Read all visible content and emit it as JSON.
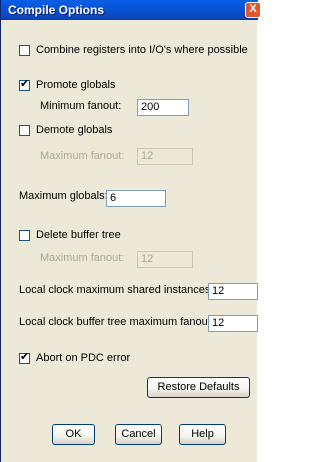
{
  "title": "Compile Options",
  "close_glyph": "X",
  "options": {
    "combine_registers": {
      "label": "Combine registers into I/O's where possible",
      "checked": false
    },
    "promote_globals": {
      "label": "Promote globals",
      "checked": true
    },
    "promote_min_fanout": {
      "label": "Minimum fanout:",
      "value": "200"
    },
    "demote_globals": {
      "label": "Demote globals",
      "checked": false
    },
    "demote_max_fanout": {
      "label": "Maximum fanout:",
      "value": "12"
    },
    "maximum_globals": {
      "label": "Maximum globals:",
      "value": "6"
    },
    "delete_buffer_tree": {
      "label": "Delete buffer tree",
      "checked": false
    },
    "delete_max_fanout": {
      "label": "Maximum fanout:",
      "value": "12"
    },
    "local_clock_shared": {
      "label": "Local clock maximum shared instances:",
      "value": "12"
    },
    "local_clock_buffer": {
      "label": "Local clock buffer tree maximum fanout:",
      "value": "12"
    },
    "abort_on_pdc": {
      "label": "Abort on PDC error",
      "checked": true
    }
  },
  "buttons": {
    "restore_defaults": "Restore Defaults",
    "ok": "OK",
    "cancel": "Cancel",
    "help": "Help"
  },
  "check_glyph": "✔"
}
